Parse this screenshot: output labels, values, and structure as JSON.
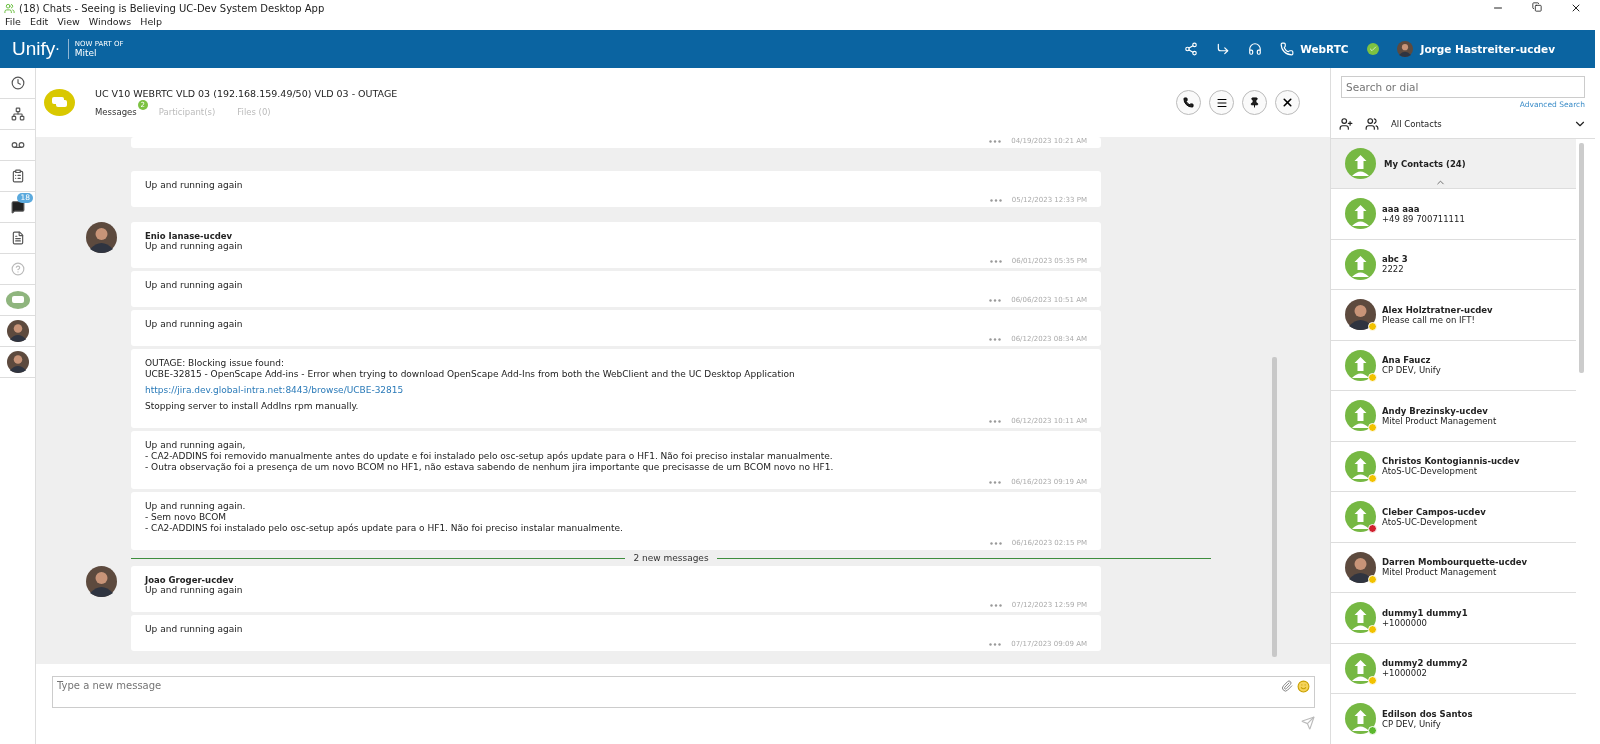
{
  "window": {
    "title": "(18) Chats - Seeing is Believing UC-Dev System Desktop App"
  },
  "menu": [
    "File",
    "Edit",
    "View",
    "Windows",
    "Help"
  ],
  "header": {
    "brand": "Unify",
    "brand_mark": "·",
    "tagline": "NOW PART OF",
    "partner": "Mitel",
    "webrtc": "WebRTC",
    "user": "Jorge Hastreiter-ucdev"
  },
  "rail": [
    {
      "kind": "clock"
    },
    {
      "kind": "network"
    },
    {
      "kind": "voicemail"
    },
    {
      "kind": "calendar"
    },
    {
      "kind": "chat",
      "badge": "18"
    },
    {
      "kind": "files"
    },
    {
      "kind": "help"
    },
    {
      "kind": "group"
    },
    {
      "kind": "person"
    },
    {
      "kind": "person"
    }
  ],
  "chat": {
    "title": "UC V10 WEBRTC VLD 03 (192.168.159.49/50) VLD 03 - OUTAGE",
    "tabs": [
      {
        "label": "Messages",
        "badge": "2",
        "selected": true
      },
      {
        "label": "Participant(s)",
        "selected": false
      },
      {
        "label": "Files (0)",
        "selected": false
      }
    ]
  },
  "messages": [
    {
      "kind": "cut",
      "time": "04/19/2023 10:21 AM"
    },
    {
      "kind": "message",
      "blocks": [
        {
          "kind": "text",
          "lines": [
            "Up and running again"
          ]
        }
      ],
      "time": "05/12/2023 12:33 PM"
    },
    {
      "kind": "message",
      "sender": "Enio Ianase-ucdev",
      "blocks": [
        {
          "kind": "text",
          "lines": [
            "Up and running again"
          ]
        }
      ],
      "time": "06/01/2023 05:35 PM"
    },
    {
      "kind": "message",
      "blocks": [
        {
          "kind": "text",
          "lines": [
            "Up and running again"
          ]
        }
      ],
      "time": "06/06/2023 10:51 AM"
    },
    {
      "kind": "message",
      "blocks": [
        {
          "kind": "text",
          "lines": [
            "Up and running again"
          ]
        }
      ],
      "time": "06/12/2023 08:34 AM"
    },
    {
      "kind": "message",
      "blocks": [
        {
          "kind": "text",
          "lines": [
            "OUTAGE: Blocking issue found:",
            "UCBE-32815 - OpenScape Add-ins - Error when trying to download OpenScape Add-Ins from both the WebClient and the UC Desktop Application"
          ]
        },
        {
          "kind": "link",
          "lines": [
            "https://jira.dev.global-intra.net:8443/browse/UCBE-32815"
          ]
        },
        {
          "kind": "text",
          "lines": [
            "Stopping server to install AddIns rpm manually."
          ]
        }
      ],
      "time": "06/12/2023 10:11 AM"
    },
    {
      "kind": "message",
      "blocks": [
        {
          "kind": "text",
          "lines": [
            "Up and running again,",
            "- CA2-ADDINS foi removido manualmente antes do update e foi instalado pelo osc-setup após update para o HF1. Não foi preciso instalar manualmente.",
            "- Outra observação foi a presença de um novo BCOM no HF1, não estava sabendo de nenhum jira importante que precisasse de um BCOM novo no HF1."
          ]
        }
      ],
      "time": "06/16/2023 09:19 AM"
    },
    {
      "kind": "message",
      "blocks": [
        {
          "kind": "text",
          "lines": [
            "Up and running again.",
            "- Sem novo BCOM",
            "- CA2-ADDINS foi instalado pelo osc-setup após update para o HF1. Não foi preciso instalar manualmente."
          ]
        }
      ],
      "time": "06/16/2023 02:15 PM"
    },
    {
      "kind": "divider",
      "label": "2 new messages"
    },
    {
      "kind": "message",
      "sender": "Joao Groger-ucdev",
      "blocks": [
        {
          "kind": "text",
          "lines": [
            "Up and running again"
          ]
        }
      ],
      "time": "07/12/2023 12:59 PM"
    },
    {
      "kind": "message",
      "blocks": [
        {
          "kind": "text",
          "lines": [
            "Up and running again"
          ]
        }
      ],
      "time": "07/17/2023 09:09 AM"
    }
  ],
  "composer": {
    "placeholder": "Type a new message"
  },
  "contacts_panel": {
    "search": {
      "placeholder": "Search or dial"
    },
    "advanced_search": "Advanced Search",
    "filter": "All Contacts",
    "group": "My Contacts (24)",
    "contacts": [
      {
        "name": "aaa aaa",
        "detail": "+49 89 700711111",
        "kind": "silhouette"
      },
      {
        "name": "abc 3",
        "detail": "2222",
        "kind": "silhouette"
      },
      {
        "name": "Alex Holztratner-ucdev",
        "detail": "Please call me on IFT!",
        "kind": "photo",
        "color": "#f2c200"
      },
      {
        "name": "Ana Faucz",
        "detail": "CP DEV, Unify",
        "kind": "silhouette",
        "color": "#f2c200"
      },
      {
        "name": "Andy Brezinsky-ucdev",
        "detail": "Mitel Product Management",
        "kind": "silhouette",
        "color": "#f2c200"
      },
      {
        "name": "Christos Kontogiannis-ucdev",
        "detail": "AtoS-UC-Development",
        "kind": "silhouette",
        "color": "#f2c200"
      },
      {
        "name": "Cleber Campos-ucdev",
        "detail": "AtoS-UC-Development",
        "kind": "silhouette",
        "color": "#d0202e"
      },
      {
        "name": "Darren Mombourquette-ucdev",
        "detail": "Mitel Product Management",
        "kind": "photo",
        "color": "#f2c200"
      },
      {
        "name": "dummy1 dummy1",
        "detail": "+1000000",
        "kind": "silhouette",
        "color": "#f2c200"
      },
      {
        "name": "dummy2 dummy2",
        "detail": "+1000002",
        "kind": "silhouette",
        "color": "#f2c200"
      },
      {
        "name": "Edilson dos Santos",
        "detail": "CP DEV, Unify",
        "kind": "silhouette",
        "color": "#5cb82e"
      }
    ]
  }
}
